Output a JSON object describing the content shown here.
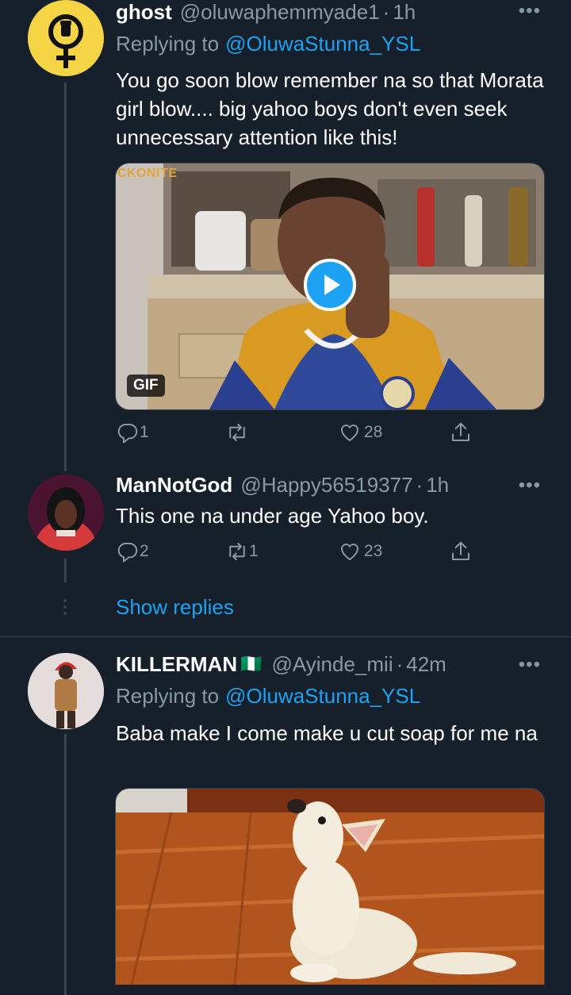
{
  "tweets": [
    {
      "name": "ghost",
      "handle": "@oluwaphemmyade1",
      "time": "1h",
      "replying_label": "Replying to",
      "replying_to": "@OluwaStunna_YSL",
      "text": "You go soon blow remember na so that Morata girl blow.... big yahoo boys don't even seek unnecessary attention like this!",
      "media_badge": "GIF",
      "media_watermark": "CKONITE",
      "replies": "1",
      "retweets": "",
      "likes": "28"
    },
    {
      "name": "ManNotGod",
      "handle": "@Happy56519377",
      "time": "1h",
      "text": "This one na under age Yahoo boy.",
      "replies": "2",
      "retweets": "1",
      "likes": "23"
    },
    {
      "name": "KILLERMAN",
      "flag": "🇳🇬",
      "handle": "@Ayinde_mii",
      "time": "42m",
      "replying_label": "Replying to",
      "replying_to": "@OluwaStunna_YSL",
      "text": "Baba make I come make u cut soap for me na"
    }
  ],
  "show_replies": "Show replies",
  "separator": "·",
  "more_glyph": "•••",
  "colors": {
    "background": "#15202b",
    "accent": "#1da1f2",
    "secondary_text": "#8899a6",
    "divider": "#38444d"
  },
  "icons": [
    "venus-fist-icon",
    "reply-icon",
    "retweet-icon",
    "like-icon",
    "share-icon",
    "play-icon"
  ]
}
